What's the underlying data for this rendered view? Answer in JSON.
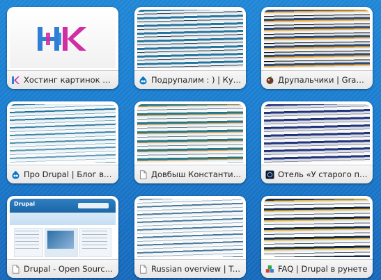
{
  "tiles": [
    {
      "label": "Хостинг картинок и из...",
      "favicon": "hk-logo-icon",
      "thumb": "logo"
    },
    {
      "label": "Подрупалим : ) | Курсы...",
      "favicon": "drupal-drop-icon",
      "thumb": "stripes"
    },
    {
      "label": "Друпальчики | Graker.Ru",
      "favicon": "graker-icon",
      "thumb": "stripes"
    },
    {
      "label": "Про Drupal | Блог вред...",
      "favicon": "drupal-drop-icon",
      "thumb": "stripes"
    },
    {
      "label": "Довбыш Константин | ...",
      "favicon": "page-icon",
      "thumb": "stripes"
    },
    {
      "label": "Отель «У старого прог...",
      "favicon": "dark-square-icon",
      "thumb": "stripes"
    },
    {
      "label": "Drupal - Open Source ...",
      "favicon": "page-icon",
      "thumb": "site"
    },
    {
      "label": "Russian overview | Tra...",
      "favicon": "page-icon",
      "thumb": "stripes"
    },
    {
      "label": "FAQ | Drupal в рунете",
      "favicon": "faq-cubes-icon",
      "thumb": "stripes"
    }
  ],
  "site_thumb": {
    "logo_text": "Drupal"
  },
  "colors": {
    "background": "#1a7ccf",
    "hk_blue": "#2f7fd6",
    "hk_pink": "#d12ea3"
  }
}
